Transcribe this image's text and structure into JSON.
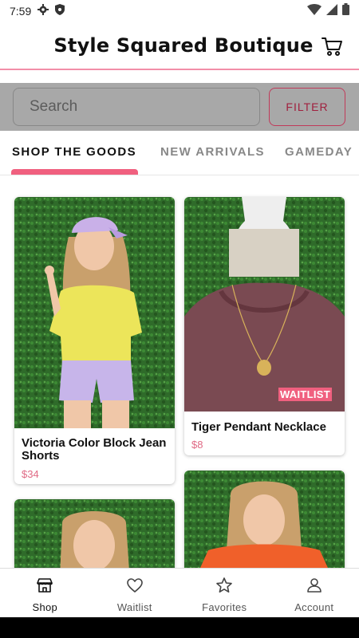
{
  "status_bar": {
    "time": "7:59"
  },
  "header": {
    "title": "Style Squared Boutique"
  },
  "search": {
    "placeholder": "Search",
    "filter_label": "FILTER"
  },
  "tabs": [
    {
      "label": "SHOP THE GOODS",
      "active": true
    },
    {
      "label": "NEW ARRIVALS",
      "active": false
    },
    {
      "label": "GAMEDAY",
      "active": false
    }
  ],
  "products": [
    {
      "name": "Victoria Color Block Jean Shorts",
      "price": "$34"
    },
    {
      "name": "Tiger Pendant Necklace",
      "price": "$8",
      "badge": "WAITLIST"
    }
  ],
  "nav": [
    {
      "label": "Shop",
      "icon": "store-icon",
      "active": true
    },
    {
      "label": "Waitlist",
      "icon": "heart-icon",
      "active": false
    },
    {
      "label": "Favorites",
      "icon": "star-icon",
      "active": false
    },
    {
      "label": "Account",
      "icon": "person-icon",
      "active": false
    }
  ],
  "colors": {
    "accent_pink": "#f0607f",
    "price_pink": "#e06a85",
    "filter_red": "#a0203e",
    "header_rule": "#f28ea8",
    "hedge_green": "#2f6b2a"
  }
}
